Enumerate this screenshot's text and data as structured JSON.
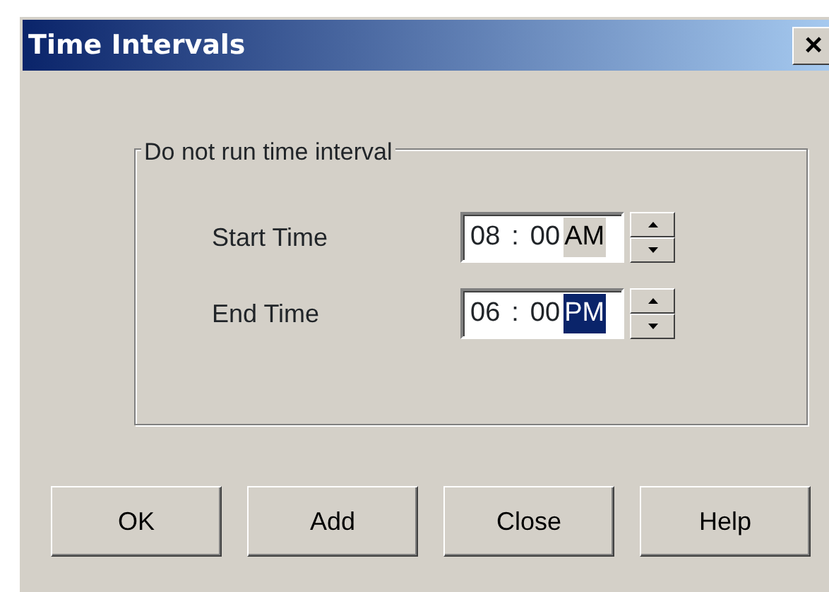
{
  "window": {
    "title": "Time Intervals",
    "close": "×"
  },
  "group": {
    "legend": "Do not run time interval"
  },
  "times": [
    {
      "label": "Start Time",
      "hour": "08",
      "separator": ":",
      "minute": "00",
      "period": "AM",
      "period_selected": false
    },
    {
      "label": "End Time",
      "hour": "06",
      "separator": ":",
      "minute": "00",
      "period": "PM",
      "period_selected": true
    }
  ],
  "buttons": [
    "OK",
    "Add",
    "Close",
    "Help"
  ]
}
